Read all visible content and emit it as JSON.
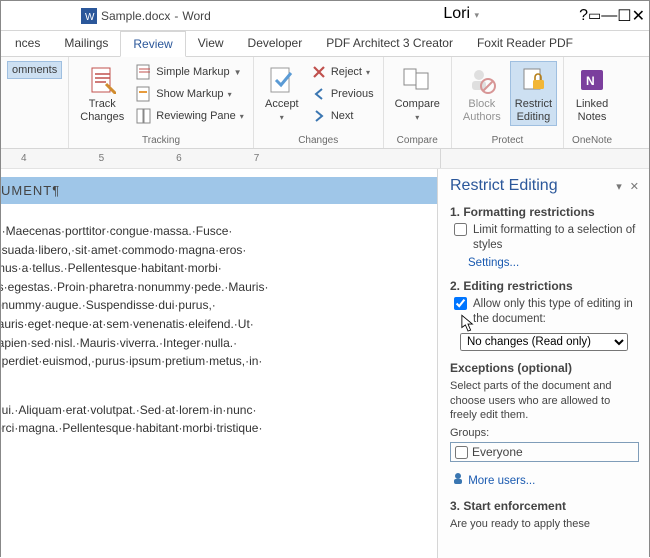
{
  "title": {
    "doc": "Sample.docx",
    "app": "Word"
  },
  "user": "Lori",
  "tabs": [
    "nces",
    "Mailings",
    "Review",
    "View",
    "Developer",
    "PDF Architect 3 Creator",
    "Foxit Reader PDF"
  ],
  "active_tab": "Review",
  "ribbon": {
    "comments_btn": "omments",
    "track": {
      "label": "Track\nChanges",
      "item1": "Simple Markup",
      "item2": "Show Markup",
      "item3": "Reviewing Pane",
      "group": "Tracking"
    },
    "accept": {
      "label": "Accept",
      "reject": "Reject",
      "previous": "Previous",
      "next": "Next",
      "group": "Changes"
    },
    "compare": {
      "label": "Compare",
      "group": "Compare"
    },
    "protect": {
      "block": "Block\nAuthors",
      "restrict": "Restrict\nEditing",
      "group": "Protect"
    },
    "onenote": {
      "label": "Linked\nNotes",
      "group": "OneNote"
    }
  },
  "ruler_marks": [
    "4",
    "5",
    "6",
    "7"
  ],
  "doc": {
    "heading": "UMENT¶",
    "body1": "t.·Maecenas·porttitor·congue·massa.·Fusce·\nesuada·libero,·sit·amet·commodo·magna·eros·\nmus·a·tellus.·Pellentesque·habitant·morbi·\nis·egestas.·Proin·pharetra·nonummy·pede.·Mauris·\nonummy·augue.·Suspendisse·dui·purus,·\nlauris·eget·neque·at·sem·venenatis·eleifend.·Ut·\nlapien·sed·nisl.·Mauris·viverra.·Integer·nulla.·\nnperdiet·euismod,·purus·ipsum·pretium·metus,·in·",
    "body2": "dui.·Aliquam·erat·volutpat.·Sed·at·lorem·in·nunc·\norci·magna.·Pellentesque·habitant·morbi·tristique·"
  },
  "panel": {
    "title": "Restrict Editing",
    "s1": {
      "title": "1. Formatting restrictions",
      "chk": "Limit formatting to a selection of styles",
      "link": "Settings..."
    },
    "s2": {
      "title": "2. Editing restrictions",
      "chk": "Allow only this type of editing in the document:",
      "select": "No changes (Read only)"
    },
    "ex": {
      "title": "Exceptions (optional)",
      "desc": "Select parts of the document and choose users who are allowed to freely edit them.",
      "groups": "Groups:",
      "everyone": "Everyone",
      "more": "More users..."
    },
    "s3": {
      "title": "3. Start enforcement",
      "prompt": "Are you ready to apply these"
    }
  }
}
